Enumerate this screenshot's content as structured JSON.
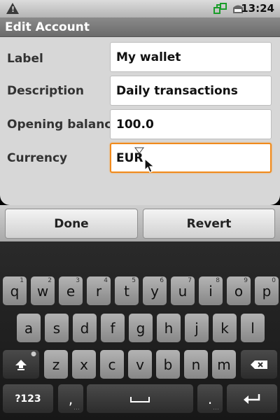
{
  "status_bar": {
    "time": "13:24",
    "warning_glyph": "!"
  },
  "title_bar": {
    "title": "Edit Account"
  },
  "form": {
    "label_label": "Label",
    "label_value": "My wallet",
    "description_label": "Description",
    "description_value": "Daily transactions",
    "opening_balance_label": "Opening balance",
    "opening_balance_value": "100.0",
    "currency_label": "Currency",
    "currency_value": "EUR"
  },
  "buttons": {
    "done": "Done",
    "revert": "Revert"
  },
  "keyboard": {
    "row1": [
      {
        "k": "q",
        "hint": "1"
      },
      {
        "k": "w",
        "hint": "2"
      },
      {
        "k": "e",
        "hint": "3"
      },
      {
        "k": "r",
        "hint": "4"
      },
      {
        "k": "t",
        "hint": "5"
      },
      {
        "k": "y",
        "hint": "6"
      },
      {
        "k": "u",
        "hint": "7"
      },
      {
        "k": "i",
        "hint": "8"
      },
      {
        "k": "o",
        "hint": "9"
      },
      {
        "k": "p",
        "hint": "0"
      }
    ],
    "row2": [
      "a",
      "s",
      "d",
      "f",
      "g",
      "h",
      "j",
      "k",
      "l"
    ],
    "row3": [
      "z",
      "x",
      "c",
      "v",
      "b",
      "n",
      "m"
    ],
    "symbols_key": "?123",
    "comma_key": ",",
    "period_key": ".",
    "shift_icon": "shift-icon",
    "delete_icon": "backspace-icon",
    "space_icon": "space-icon",
    "enter_icon": "enter-icon"
  },
  "colors": {
    "focus": "#f08a1c",
    "panel": "#d7d7d7"
  }
}
